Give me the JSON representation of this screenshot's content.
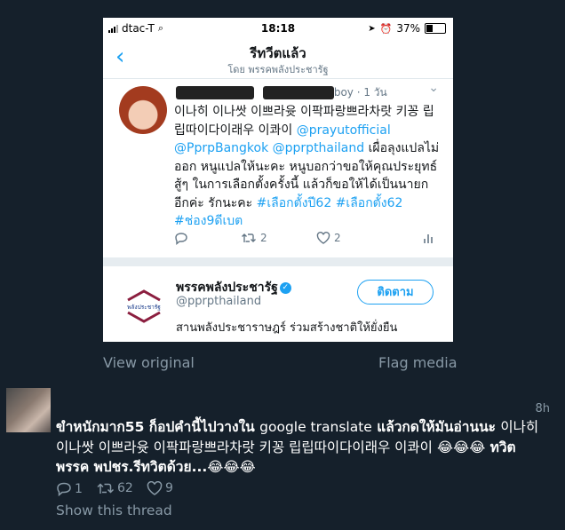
{
  "phone": {
    "status": {
      "carrier": "dtac-T",
      "time": "18:18",
      "battery": "37%",
      "battery_level": 0.37
    },
    "nav": {
      "title": "รีทวีตแล้ว",
      "subtitle": "โดย พรรคพลังประชารัฐ"
    },
    "tweet": {
      "handle_tail": "boy",
      "time": "· 1 วัน",
      "body_before": "이나히 이나쌋 이쁘라윳 이팍파랑쁘라차랏 키꽁 립립따이다이래우 이콰이 ",
      "mention1": "@prayutofficial",
      "mention2": "@PprpBangkok",
      "mention3": "@pprpthailand",
      "body_mid": " เผื่อลุงแปลไม่ออก หนูแปลให้นะคะ หนูบอกว่าขอให้คุณประยุทธ์สู้ๆ ในการเลือกตั้งครั้งนี้ แล้วก็ขอให้ได้เป็นนายกอีกค่ะ รักนะคะ ",
      "hashtag1": "#เลือกตั้งปี62",
      "hashtag2": "#เลือกตั้ง62",
      "hashtag3": "#ช่อง9ดีเบต",
      "retweets": "2",
      "likes": "2"
    },
    "suggestion": {
      "name": "พรรคพลังประชารัฐ",
      "handle": "@pprpthailand",
      "follow_label": "ติดตาม",
      "bio": "สานพลังประชาราษฎร์ ร่วมสร้างชาติให้ยั่งยืน",
      "logo_text": "พลังประชารัฐ"
    }
  },
  "media_actions": {
    "view_original": "View original",
    "flag_media": "Flag media"
  },
  "reply": {
    "time": "8h",
    "text_bold1": "ขำหนักมาก55 ก็อปคำนี้ไปวางใน ",
    "text_plain1": "google translate",
    "text_bold2": " แล้วกดให้มันอ่านนะ ",
    "text_plain2": "이나히 이나쌋 이쁘라윳 이팍파랑쁘라차랏 키꽁 립립따이다이래우 이콰이",
    "emoji1": "😂😂😂",
    "text_bold3": " ทวิต พรรค พปชร.รีทวิตด้วย...",
    "emoji2": "😂😂😂",
    "replies": "1",
    "retweets": "62",
    "likes": "9",
    "show_thread": "Show this thread"
  },
  "colors": {
    "background": "#15202b",
    "twitter_blue": "#1da1f2",
    "muted": "#8899a6"
  }
}
